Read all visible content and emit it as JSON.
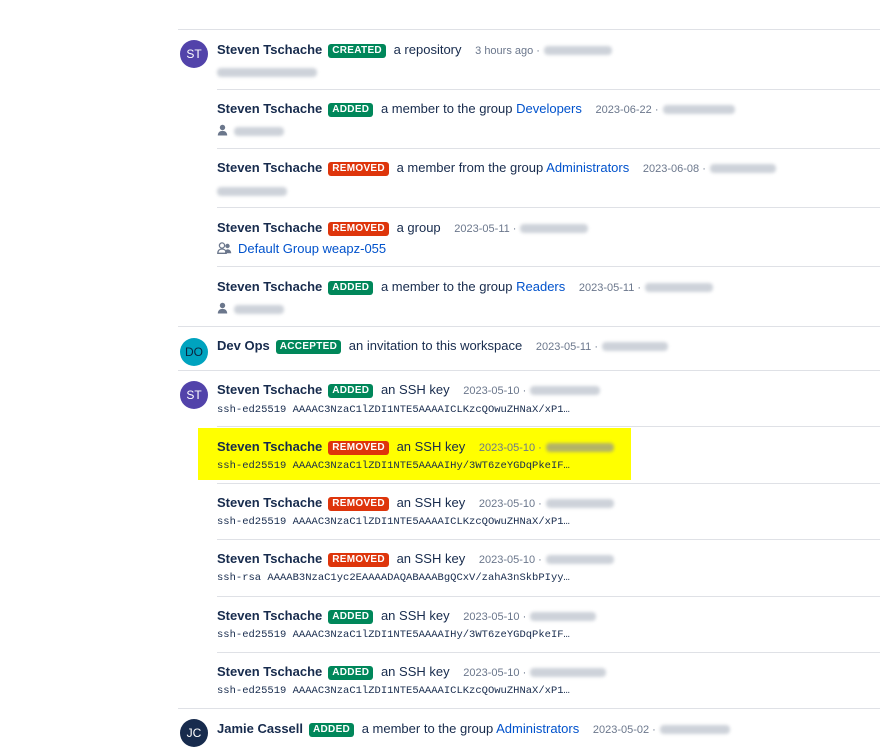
{
  "entries": [
    {
      "actor": "Steven Tschache",
      "initials": "ST",
      "badge": "CREATED",
      "badge_color": "#00875a",
      "action": "a repository",
      "target": "",
      "time": "3 hours ago",
      "detail_type": "blur"
    },
    {
      "actor": "Steven Tschache",
      "badge": "ADDED",
      "badge_color": "#00875a",
      "action": "a member to the group",
      "target": "Developers",
      "time": "2023-06-22",
      "detail_type": "user"
    },
    {
      "actor": "Steven Tschache",
      "badge": "REMOVED",
      "badge_color": "#de350b",
      "action": "a member from the group",
      "target": "Administrators",
      "time": "2023-06-08",
      "detail_type": "blur"
    },
    {
      "actor": "Steven Tschache",
      "badge": "REMOVED",
      "badge_color": "#de350b",
      "action": "a group",
      "target": "",
      "time": "2023-05-11",
      "detail_type": "group",
      "detail": "Default Group weapz-055"
    },
    {
      "actor": "Steven Tschache",
      "badge": "ADDED",
      "badge_color": "#00875a",
      "action": "a member to the group",
      "target": "Readers",
      "time": "2023-05-11",
      "detail_type": "user"
    },
    {
      "actor": "Dev Ops",
      "initials": "DO",
      "badge": "ACCEPTED",
      "badge_color": "#00875a",
      "action": "an invitation to this workspace",
      "target": "",
      "time": "2023-05-11"
    },
    {
      "actor": "Steven Tschache",
      "initials": "ST",
      "badge": "ADDED",
      "badge_color": "#00875a",
      "action": "an SSH key",
      "target": "",
      "time": "2023-05-10",
      "detail": "ssh-ed25519 AAAAC3NzaC1lZDI1NTE5AAAAICLKzcQOwuZHNaX/xP1…"
    },
    {
      "actor": "Steven Tschache",
      "badge": "REMOVED",
      "badge_color": "#de350b",
      "action": "an SSH key",
      "target": "",
      "time": "2023-05-10",
      "detail": "ssh-ed25519 AAAAC3NzaC1lZDI1NTE5AAAAIHy/3WT6zeYGDqPkeIF…",
      "highlighted": true
    },
    {
      "actor": "Steven Tschache",
      "badge": "REMOVED",
      "badge_color": "#de350b",
      "action": "an SSH key",
      "target": "",
      "time": "2023-05-10",
      "detail": "ssh-ed25519 AAAAC3NzaC1lZDI1NTE5AAAAICLKzcQOwuZHNaX/xP1…"
    },
    {
      "actor": "Steven Tschache",
      "badge": "REMOVED",
      "badge_color": "#de350b",
      "action": "an SSH key",
      "target": "",
      "time": "2023-05-10",
      "detail": "ssh-rsa AAAAB3NzaC1yc2EAAAADAQABAAABgQCxV/zahA3nSkbPIyy…"
    },
    {
      "actor": "Steven Tschache",
      "badge": "ADDED",
      "badge_color": "#00875a",
      "action": "an SSH key",
      "target": "",
      "time": "2023-05-10",
      "detail": "ssh-ed25519 AAAAC3NzaC1lZDI1NTE5AAAAIHy/3WT6zeYGDqPkeIF…"
    },
    {
      "actor": "Steven Tschache",
      "badge": "ADDED",
      "badge_color": "#00875a",
      "action": "an SSH key",
      "target": "",
      "time": "2023-05-10",
      "detail": "ssh-ed25519 AAAAC3NzaC1lZDI1NTE5AAAAICLKzcQOwuZHNaX/xP1…"
    },
    {
      "actor": "Jamie Cassell",
      "initials": "JC",
      "badge": "ADDED",
      "badge_color": "#00875a",
      "action": "a member to the group",
      "target": "Administrators",
      "time": "2023-05-02"
    }
  ]
}
